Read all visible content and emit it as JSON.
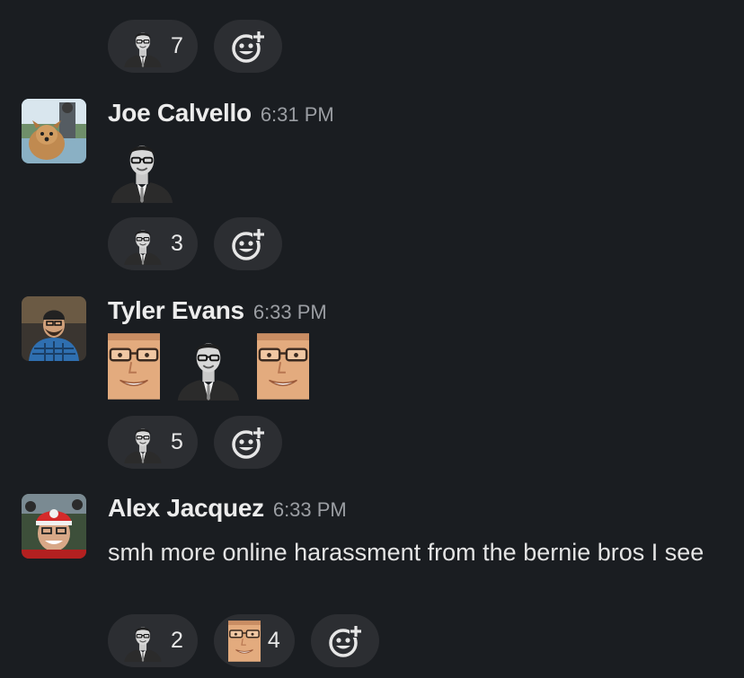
{
  "colors": {
    "background": "#1a1d21",
    "pill": "#2c2e32",
    "name": "#ececec",
    "time": "#9b9ea3",
    "text": "#e4e4e4"
  },
  "top_reactions": [
    {
      "emoji": "suit-man-emoji",
      "count": "7"
    }
  ],
  "messages": [
    {
      "author": "Joe Calvello",
      "time": "6:31 PM",
      "avatar": "dog-avatar",
      "content": {
        "type": "emoji",
        "emojis": [
          "suit-man-emoji"
        ]
      },
      "reactions": [
        {
          "emoji": "suit-man-emoji",
          "count": "3"
        }
      ]
    },
    {
      "author": "Tyler Evans",
      "time": "6:33 PM",
      "avatar": "beanie-avatar",
      "content": {
        "type": "emoji",
        "emojis": [
          "face-closeup-emoji",
          "suit-man-emoji",
          "face-closeup-emoji"
        ]
      },
      "reactions": [
        {
          "emoji": "suit-man-emoji",
          "count": "5"
        }
      ]
    },
    {
      "author": "Alex Jacquez",
      "time": "6:33 PM",
      "avatar": "red-hat-avatar",
      "content": {
        "type": "text",
        "text": "smh more online harassment from the bernie bros I see"
      },
      "reactions": [
        {
          "emoji": "suit-man-emoji",
          "count": "2"
        },
        {
          "emoji": "face-closeup-emoji",
          "count": "4"
        }
      ]
    }
  ],
  "add_reaction_icon": "add-reaction-icon"
}
